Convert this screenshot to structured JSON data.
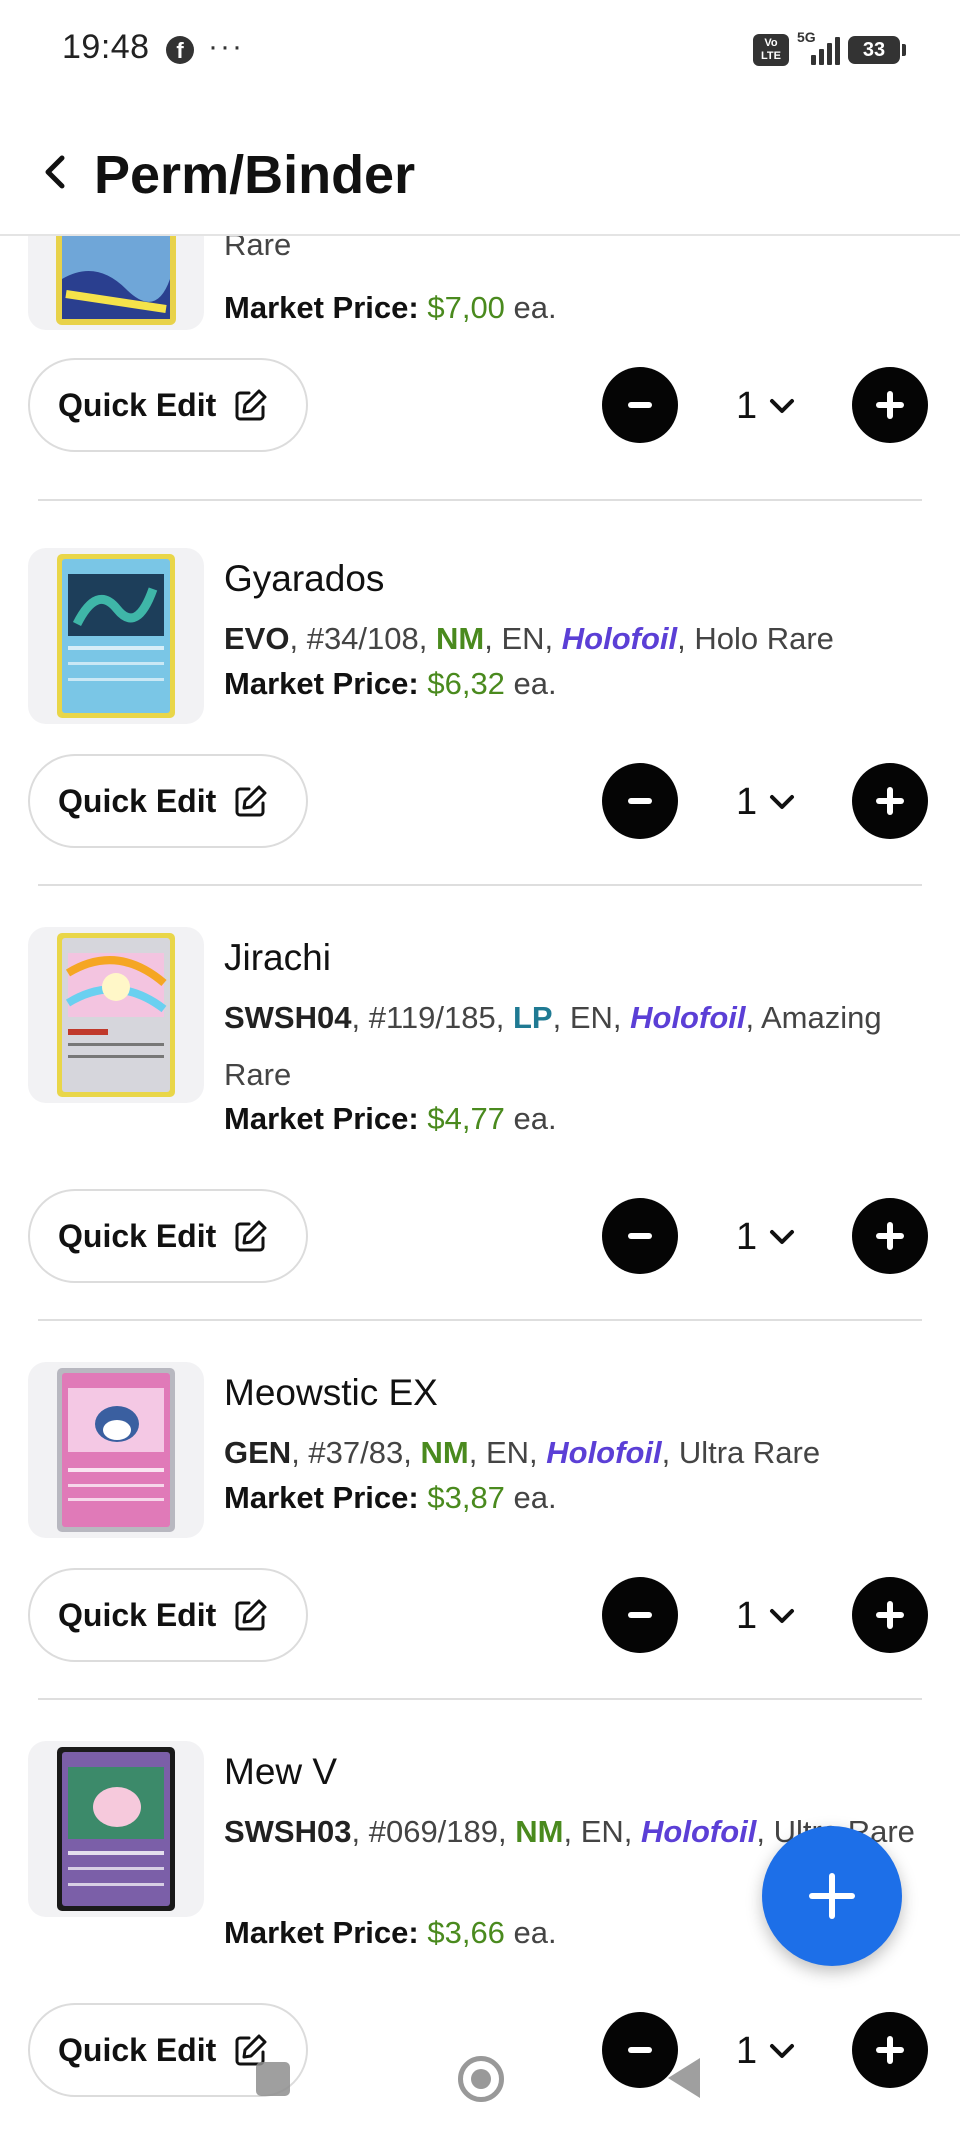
{
  "status_bar": {
    "time": "19:48",
    "notification_icons": [
      "facebook-icon",
      "more-icon"
    ],
    "more": "···",
    "volte": "Vo LTE",
    "network": "5G",
    "battery": "33"
  },
  "header": {
    "back_icon": "chevron-left-icon",
    "title": "Perm/Binder"
  },
  "labels": {
    "quick_edit": "Quick Edit",
    "market_price": "Market Price:",
    "each": "ea."
  },
  "colors": {
    "price_green": "#4a8a1e",
    "nm_green": "#4a8a1e",
    "lp_teal": "#1f7a93",
    "holofoil_purple": "#5b3fd6",
    "fab_blue": "#1d6fe8"
  },
  "cards": [
    {
      "name": "",
      "set": "",
      "number": "",
      "condition": "",
      "language": "",
      "printing": "",
      "rarity": "Rare",
      "price": "$7,00",
      "quantity": "1"
    },
    {
      "name": "Gyarados",
      "set": "EVO",
      "number": "#34/108",
      "condition": "NM",
      "language": "EN",
      "printing": "Holofoil",
      "rarity": "Holo Rare",
      "price": "$6,32",
      "quantity": "1"
    },
    {
      "name": "Jirachi",
      "set": "SWSH04",
      "number": "#119/185",
      "condition": "LP",
      "language": "EN",
      "printing": "Holofoil",
      "rarity": "Amazing Rare",
      "price": "$4,77",
      "quantity": "1"
    },
    {
      "name": "Meowstic EX",
      "set": "GEN",
      "number": "#37/83",
      "condition": "NM",
      "language": "EN",
      "printing": "Holofoil",
      "rarity": "Ultra Rare",
      "price": "$3,87",
      "quantity": "1"
    },
    {
      "name": "Mew V",
      "set": "SWSH03",
      "number": "#069/189",
      "condition": "NM",
      "language": "EN",
      "printing": "Holofoil",
      "rarity": "Ultra Rare",
      "price": "$3,66",
      "quantity": "1"
    }
  ],
  "fab": {
    "icon": "plus-icon"
  },
  "system_nav": {
    "icons": [
      "recents-icon",
      "home-icon",
      "back-icon"
    ]
  }
}
